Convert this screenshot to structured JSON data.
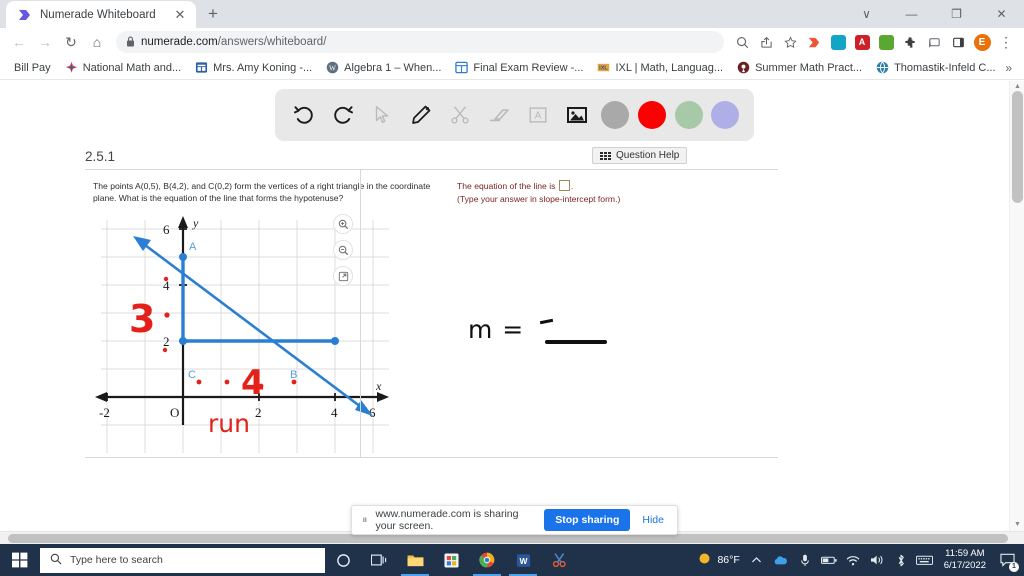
{
  "browser": {
    "tab": {
      "title": "Numerade Whiteboard",
      "favicon": "numerade-logo-icon",
      "close": "✕"
    },
    "newtab_label": "+",
    "window_controls": {
      "dropdown": "∨",
      "minimize": "—",
      "maximize": "❐",
      "close": "✕"
    },
    "nav": {
      "back": "←",
      "forward": "→",
      "reload": "↻",
      "home": "⌂"
    },
    "omnibox": {
      "lock": "🔒",
      "url_domain": "numerade.com",
      "url_path": "/answers/whiteboard/"
    },
    "toolbar_icons": [
      {
        "name": "zoom-search-icon",
        "glyph": "⚲"
      },
      {
        "name": "share-icon",
        "glyph": "⤴"
      },
      {
        "name": "bookmark-star-icon",
        "glyph": "☆"
      },
      {
        "name": "extension-numerade-icon",
        "color": "#ef4a3b"
      },
      {
        "name": "extension-teal-icon",
        "color": "#12a5c6"
      },
      {
        "name": "extension-adobe-pdf-icon",
        "color": "#cc2127"
      },
      {
        "name": "extension-green-icon",
        "color": "#4caf50"
      },
      {
        "name": "extensions-puzzle-icon",
        "glyph": "❖"
      },
      {
        "name": "cast-icon",
        "glyph": "⎐"
      },
      {
        "name": "side-panel-icon",
        "glyph": "▣"
      }
    ],
    "profile_initial": "E",
    "menu_icon": "⋮",
    "bookmarks": [
      {
        "label": "Bill Pay",
        "icon": "none",
        "color": ""
      },
      {
        "label": "National Math and...",
        "icon": "star-burst-icon",
        "color": "#e8453c"
      },
      {
        "label": "Mrs. Amy Koning -...",
        "icon": "blue-square-icon",
        "color": "#2f5fa8"
      },
      {
        "label": "Algebra 1 – When...",
        "icon": "wordpress-icon",
        "color": "#6b7f8e"
      },
      {
        "label": "Final Exam Review -...",
        "icon": "blue-outline-icon",
        "color": "#2f7fd1"
      },
      {
        "label": "IXL | Math, Languag...",
        "icon": "ixl-icon",
        "color": "#e8a33d"
      },
      {
        "label": "Summer Math Pract...",
        "icon": "dark-circle-icon",
        "color": "#8e2b2b"
      },
      {
        "label": "Thomastik-Infeld C...",
        "icon": "globe-icon",
        "color": "#2f6f9e"
      }
    ],
    "bookmarks_overflow": "»"
  },
  "whiteboard": {
    "palette": {
      "tools": [
        {
          "name": "undo-icon",
          "label": "Undo",
          "disabled": false
        },
        {
          "name": "redo-icon",
          "label": "Redo",
          "disabled": false
        },
        {
          "name": "cursor-select-icon",
          "label": "Select",
          "disabled": true
        },
        {
          "name": "pencil-icon",
          "label": "Pencil",
          "disabled": false
        },
        {
          "name": "scissors-icon",
          "label": "Cut",
          "disabled": true
        },
        {
          "name": "eraser-icon",
          "label": "Eraser",
          "disabled": true
        },
        {
          "name": "text-box-icon",
          "label": "Text",
          "disabled": true
        },
        {
          "name": "image-icon",
          "label": "Image",
          "disabled": false
        }
      ],
      "colors": [
        {
          "name": "color-gray",
          "hex": "#a9a9a9"
        },
        {
          "name": "color-red",
          "hex": "#fa0000"
        },
        {
          "name": "color-green",
          "hex": "#a7c9a7"
        },
        {
          "name": "color-purple",
          "hex": "#afafe8"
        }
      ]
    },
    "worksheet": {
      "section_label": "2.5.1",
      "question_help": "Question Help",
      "prompt": "The points A(0,5), B(4,2), and C(0,2) form the vertices of a right triangle in the coordinate plane. What is the equation of the line that forms the hypotenuse?",
      "answer_prefix": "The equation of the line is",
      "answer_suffix": ".",
      "answer_hint": "(Type your answer in slope-intercept form.)"
    },
    "map_controls": [
      {
        "name": "zoom-in-icon",
        "glyph": "⊕"
      },
      {
        "name": "zoom-out-icon",
        "glyph": "⊖"
      },
      {
        "name": "open-external-icon",
        "glyph": "↗"
      }
    ],
    "annotations": {
      "m_equals": "m =",
      "rise_label": "3",
      "run_label": "4",
      "run_word": "run",
      "ink_color_red": "#e32119",
      "ink_color_black": "#101010"
    }
  },
  "chart_data": {
    "type": "scatter",
    "title": "Right triangle with hypotenuse on coordinate plane",
    "xlabel": "x",
    "ylabel": "y",
    "xlim": [
      -2.6,
      6.8
    ],
    "ylim": [
      -1.2,
      6.8
    ],
    "xticks": [
      -2,
      0,
      2,
      4,
      6
    ],
    "xtick_labels": [
      "-2",
      "O",
      "2",
      "4",
      "6"
    ],
    "yticks": [
      2,
      4,
      6
    ],
    "ytick_labels": [
      "2",
      "4",
      "6"
    ],
    "grid": true,
    "grid_color": "#d9d9d9",
    "line_color": "#2a7fd4",
    "points": [
      {
        "label": "A",
        "x": 0,
        "y": 5
      },
      {
        "label": "B",
        "x": 4,
        "y": 2
      },
      {
        "label": "C",
        "x": 0,
        "y": 2
      }
    ],
    "segments": [
      {
        "name": "leg-AC",
        "from": [
          0,
          5
        ],
        "to": [
          0,
          2
        ]
      },
      {
        "name": "leg-CB",
        "from": [
          0,
          2
        ],
        "to": [
          4,
          2
        ]
      },
      {
        "name": "hypotenuse-line",
        "from": [
          -1.2,
          5.9
        ],
        "to": [
          5.8,
          0.65
        ],
        "arrows": "both"
      }
    ],
    "annotations": [
      {
        "text": "3",
        "x": -1.2,
        "y": 3.6,
        "color": "#e32119",
        "meaning": "rise"
      },
      {
        "text": "4",
        "x": 2.1,
        "y": 1.35,
        "color": "#e32119",
        "meaning": "run-value"
      },
      {
        "text": "run",
        "x": 1.3,
        "y": 0.45,
        "color": "#e32119",
        "meaning": "run-label"
      }
    ]
  },
  "share_bar": {
    "grip": "⏸",
    "message": "www.numerade.com is sharing your screen.",
    "stop_label": "Stop sharing",
    "hide_label": "Hide"
  },
  "taskbar": {
    "start_icon": "windows-start-icon",
    "search_placeholder": "Type here to search",
    "apps": [
      {
        "name": "cortana-icon",
        "glyph": "○",
        "active": false
      },
      {
        "name": "task-view-icon",
        "glyph": "⌸",
        "active": false
      },
      {
        "name": "file-explorer-icon",
        "glyph": "🗁",
        "active": true
      },
      {
        "name": "microsoft-store-icon",
        "glyph": "⊞",
        "active": false
      },
      {
        "name": "chrome-icon",
        "glyph": "◉",
        "active": true
      },
      {
        "name": "word-icon",
        "glyph": "W",
        "active": true
      },
      {
        "name": "snip-sketch-icon",
        "glyph": "✂",
        "active": false
      }
    ],
    "weather_temp": "86°F",
    "tray": [
      {
        "name": "show-hidden-icons",
        "glyph": "∧"
      },
      {
        "name": "onedrive-icon",
        "glyph": "☁"
      },
      {
        "name": "microphone-icon",
        "glyph": "🎤"
      },
      {
        "name": "battery-icon",
        "glyph": "▭"
      },
      {
        "name": "wifi-icon",
        "glyph": "◠"
      },
      {
        "name": "volume-icon",
        "glyph": "🔊"
      },
      {
        "name": "bluetooth-icon",
        "glyph": "฿"
      },
      {
        "name": "keyboard-icon",
        "glyph": "⌨"
      }
    ],
    "time": "11:59 AM",
    "date": "6/17/2022",
    "notification_count": "1"
  }
}
